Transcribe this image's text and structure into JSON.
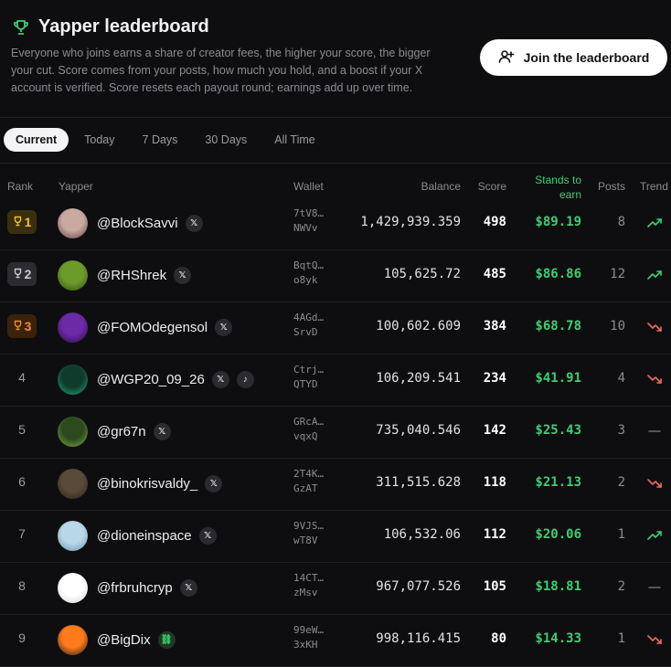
{
  "header": {
    "title": "Yapper leaderboard",
    "description": "Everyone who joins earns a share of creator fees, the higher your score, the bigger your cut. Score comes from your posts, how much you hold, and a boost if your X account is verified. Score resets each payout round; earnings add up over time.",
    "join_label": "Join the leaderboard"
  },
  "tabs": [
    "Current",
    "Today",
    "7 Days",
    "30 Days",
    "All Time"
  ],
  "columns": {
    "rank": "Rank",
    "yapper": "Yapper",
    "wallet": "Wallet",
    "balance": "Balance",
    "score": "Score",
    "earn": "Stands to earn",
    "posts": "Posts",
    "trend": "Trend"
  },
  "colors": {
    "accent_green": "#3ccf72",
    "gold": "#f2c230",
    "silver": "#c9c9cf",
    "bronze": "#f08c2b",
    "down": "#f06a5a"
  },
  "rows": [
    {
      "rank": "1",
      "user": "@BlockSavvi",
      "wallet1": "7tV8…",
      "wallet2": "NWVv",
      "balance": "1,429,939.359",
      "score": "498",
      "earn": "$89.19",
      "posts": "8",
      "trend": "up"
    },
    {
      "rank": "2",
      "user": "@RHShrek",
      "wallet1": "BqtQ…",
      "wallet2": "o8yk",
      "balance": "105,625.72",
      "score": "485",
      "earn": "$86.86",
      "posts": "12",
      "trend": "up"
    },
    {
      "rank": "3",
      "user": "@FOMOdegensol",
      "wallet1": "4AGd…",
      "wallet2": "SrvD",
      "balance": "100,602.609",
      "score": "384",
      "earn": "$68.78",
      "posts": "10",
      "trend": "down"
    },
    {
      "rank": "4",
      "user": "@WGP20_09_26",
      "wallet1": "Ctrj…",
      "wallet2": "QTYD",
      "balance": "106,209.541",
      "score": "234",
      "earn": "$41.91",
      "posts": "4",
      "trend": "down"
    },
    {
      "rank": "5",
      "user": "@gr67n",
      "wallet1": "GRcA…",
      "wallet2": "vqxQ",
      "balance": "735,040.546",
      "score": "142",
      "earn": "$25.43",
      "posts": "3",
      "trend": "flat"
    },
    {
      "rank": "6",
      "user": "@binokrisvaldy_",
      "wallet1": "2T4K…",
      "wallet2": "GzAT",
      "balance": "311,515.628",
      "score": "118",
      "earn": "$21.13",
      "posts": "2",
      "trend": "down"
    },
    {
      "rank": "7",
      "user": "@dioneinspace",
      "wallet1": "9VJS…",
      "wallet2": "wT8V",
      "balance": "106,532.06",
      "score": "112",
      "earn": "$20.06",
      "posts": "1",
      "trend": "up"
    },
    {
      "rank": "8",
      "user": "@frbruhcryp",
      "wallet1": "14CT…",
      "wallet2": "zMsv",
      "balance": "967,077.526",
      "score": "105",
      "earn": "$18.81",
      "posts": "2",
      "trend": "flat"
    },
    {
      "rank": "9",
      "user": "@BigDix",
      "wallet1": "99eW…",
      "wallet2": "3xKH",
      "balance": "998,116.415",
      "score": "80",
      "earn": "$14.33",
      "posts": "1",
      "trend": "down"
    }
  ]
}
